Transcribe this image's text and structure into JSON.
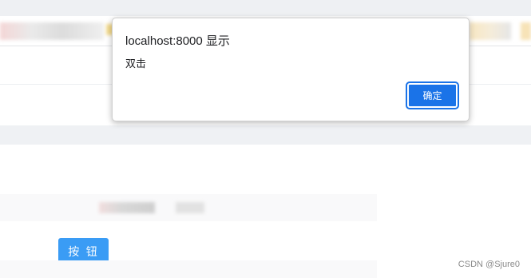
{
  "dialog": {
    "title": "localhost:8000 显示",
    "message": "双击",
    "ok_label": "确定"
  },
  "page": {
    "button_label": "按 钮"
  },
  "watermark": {
    "text": "CSDN @Sjure0"
  },
  "colors": {
    "dialog_button": "#1a73e8",
    "page_button": "#3a9cf5",
    "chrome_gray": "#eef0f3"
  }
}
